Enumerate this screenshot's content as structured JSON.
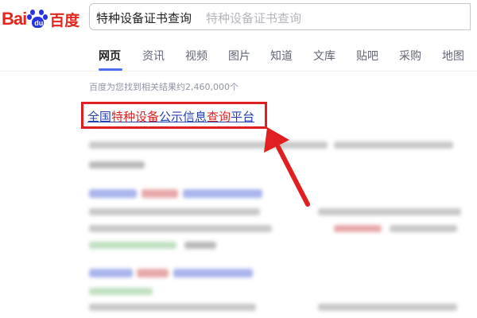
{
  "logo": {
    "latin_left": "Bai",
    "paw_text": "du",
    "chinese": "百度"
  },
  "search": {
    "query": "特种设备证书查询",
    "suggestion": "特种设备证书查询"
  },
  "tabs": [
    "网页",
    "资讯",
    "视频",
    "图片",
    "知道",
    "文库",
    "贴吧",
    "采购",
    "地图"
  ],
  "active_tab": "网页",
  "results_count": "百度为您找到相关结果约2,460,000个",
  "first_result": {
    "parts": [
      {
        "text": "全国",
        "highlight": false
      },
      {
        "text": "特种设备",
        "highlight": true
      },
      {
        "text": "公示信息",
        "highlight": false
      },
      {
        "text": "查询",
        "highlight": true
      },
      {
        "text": "平台",
        "highlight": false
      }
    ]
  },
  "colors": {
    "brand_red": "#e1261c",
    "brand_blue": "#2932e1",
    "link": "#2440b3",
    "annotation_red": "#e02020",
    "tab_accent": "#4e6ef2"
  }
}
